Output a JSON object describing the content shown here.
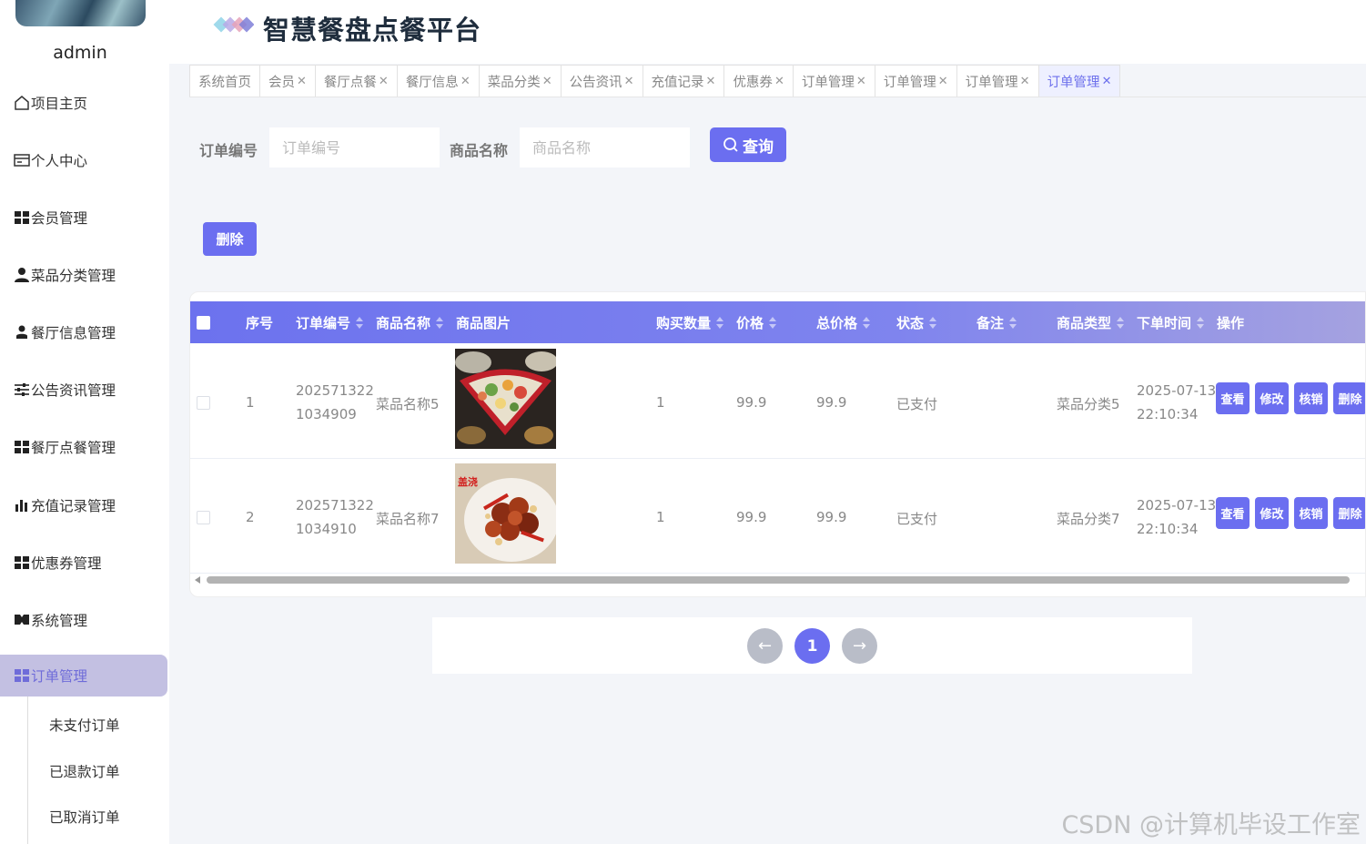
{
  "user": {
    "name": "admin"
  },
  "app": {
    "title": "智慧餐盘点餐平台"
  },
  "menu": {
    "items": [
      {
        "label": "项目主页",
        "icon": "home-icon"
      },
      {
        "label": "个人中心",
        "icon": "card-icon"
      },
      {
        "label": "会员管理",
        "icon": "grid-icon"
      },
      {
        "label": "菜品分类管理",
        "icon": "user-icon"
      },
      {
        "label": "餐厅信息管理",
        "icon": "person-icon"
      },
      {
        "label": "公告资讯管理",
        "icon": "sliders-icon"
      },
      {
        "label": "餐厅点餐管理",
        "icon": "grid-icon"
      },
      {
        "label": "充值记录管理",
        "icon": "bar-chart-icon"
      },
      {
        "label": "优惠券管理",
        "icon": "grid-icon"
      },
      {
        "label": "系统管理",
        "icon": "settings-icon"
      },
      {
        "label": "订单管理",
        "icon": "grid-icon"
      }
    ],
    "active_index": 10,
    "subitems": [
      "未支付订单",
      "已退款订单",
      "已取消订单"
    ]
  },
  "tabs": [
    {
      "label": "系统首页",
      "closable": false
    },
    {
      "label": "会员",
      "closable": true
    },
    {
      "label": "餐厅点餐",
      "closable": true
    },
    {
      "label": "餐厅信息",
      "closable": true
    },
    {
      "label": "菜品分类",
      "closable": true
    },
    {
      "label": "公告资讯",
      "closable": true
    },
    {
      "label": "充值记录",
      "closable": true
    },
    {
      "label": "优惠券",
      "closable": true
    },
    {
      "label": "订单管理",
      "closable": true
    },
    {
      "label": "订单管理",
      "closable": true
    },
    {
      "label": "订单管理",
      "closable": true
    },
    {
      "label": "订单管理",
      "closable": true,
      "active": true
    }
  ],
  "search": {
    "order_no_label": "订单编号",
    "order_no_placeholder": "订单编号",
    "goods_name_label": "商品名称",
    "goods_name_placeholder": "商品名称",
    "query_button": "查询"
  },
  "toolbar": {
    "delete_button": "删除"
  },
  "table": {
    "columns": {
      "index": "序号",
      "order_no": "订单编号",
      "goods_name": "商品名称",
      "image": "商品图片",
      "quantity": "购买数量",
      "price": "价格",
      "total": "总价格",
      "status": "状态",
      "remark": "备注",
      "goods_type": "商品类型",
      "order_time": "下单时间",
      "ops": "操作"
    },
    "rows": [
      {
        "index": "1",
        "order_no_1": "202571322",
        "order_no_2": "1034909",
        "goods_name": "菜品名称5",
        "quantity": "1",
        "price": "99.9",
        "total": "99.9",
        "status": "已支付",
        "remark": "",
        "goods_type": "菜品分类5",
        "date": "2025-07-13",
        "time": "22:10:34"
      },
      {
        "index": "2",
        "order_no_1": "202571322",
        "order_no_2": "1034910",
        "goods_name": "菜品名称7",
        "quantity": "1",
        "price": "99.9",
        "total": "99.9",
        "status": "已支付",
        "remark": "",
        "goods_type": "菜品分类7",
        "date": "2025-07-13",
        "time": "22:10:34"
      }
    ],
    "row_ops": [
      "查看",
      "修改",
      "核销",
      "删除"
    ],
    "image2_text": "盖浇"
  },
  "pagination": {
    "prev": "←",
    "current": "1",
    "next": "→"
  },
  "watermark": "CSDN @计算机毕设工作室",
  "colors": {
    "primary": "#6b6ef0",
    "active_menu_bg": "#c3c0e2"
  }
}
